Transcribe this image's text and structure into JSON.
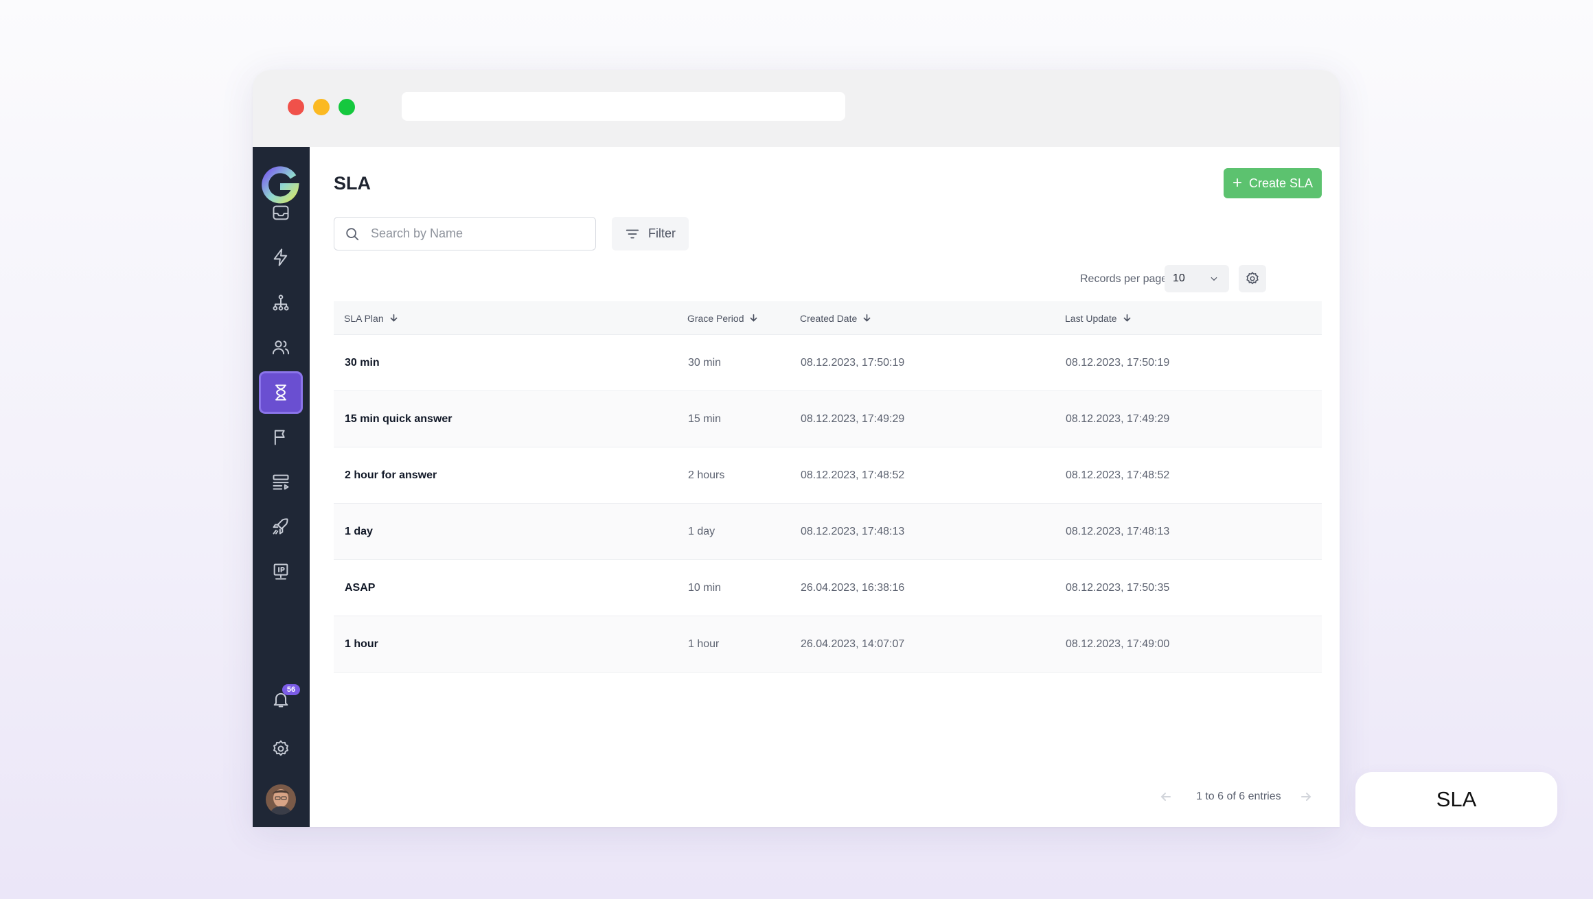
{
  "sidebar": {
    "nav": [
      {
        "icon": "inbox-icon",
        "active": false
      },
      {
        "icon": "lightning-icon",
        "active": false
      },
      {
        "icon": "hierarchy-icon",
        "active": false
      },
      {
        "icon": "users-icon",
        "active": false
      },
      {
        "icon": "hourglass-icon",
        "active": true
      },
      {
        "icon": "flag-icon",
        "active": false
      },
      {
        "icon": "routing-icon",
        "active": false
      },
      {
        "icon": "rocket-icon",
        "active": false
      },
      {
        "icon": "ip-monitor-icon",
        "active": false
      }
    ],
    "notifications_count": "56",
    "accent_color": "#6a4fd1",
    "background_color": "#1f2736"
  },
  "page": {
    "title": "SLA",
    "create_button_label": "Create SLA",
    "create_button_color": "#5cc26f",
    "search_placeholder": "Search by Name",
    "filter_label": "Filter",
    "records_per_page_label": "Records per page",
    "records_per_page_value": "10"
  },
  "table": {
    "columns": [
      "SLA Plan",
      "Grace Period",
      "Created Date",
      "Last Update"
    ],
    "rows": [
      {
        "plan": "30 min",
        "grace": "30 min",
        "created": "08.12.2023, 17:50:19",
        "updated": "08.12.2023, 17:50:19"
      },
      {
        "plan": "15 min quick answer",
        "grace": "15 min",
        "created": "08.12.2023, 17:49:29",
        "updated": "08.12.2023, 17:49:29"
      },
      {
        "plan": "2 hour for answer",
        "grace": "2 hours",
        "created": "08.12.2023, 17:48:52",
        "updated": "08.12.2023, 17:48:52"
      },
      {
        "plan": "1 day",
        "grace": "1 day",
        "created": "08.12.2023, 17:48:13",
        "updated": "08.12.2023, 17:48:13"
      },
      {
        "plan": "ASAP",
        "grace": "10 min",
        "created": "26.04.2023, 16:38:16",
        "updated": "08.12.2023, 17:50:35"
      },
      {
        "plan": "1 hour",
        "grace": "1 hour",
        "created": "26.04.2023, 14:07:07",
        "updated": "08.12.2023, 17:49:00"
      }
    ]
  },
  "pagination": {
    "summary": "1 to 6 of 6 entries"
  },
  "caption": "SLA"
}
